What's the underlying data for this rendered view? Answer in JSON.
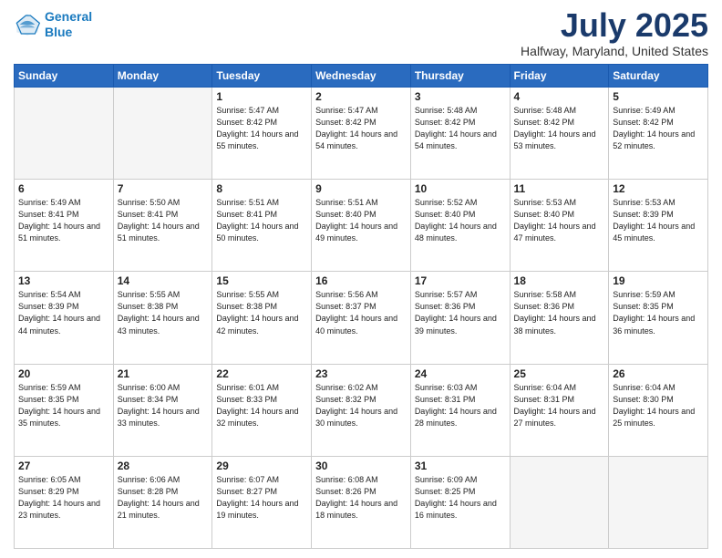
{
  "logo": {
    "line1": "General",
    "line2": "Blue"
  },
  "title": "July 2025",
  "subtitle": "Halfway, Maryland, United States",
  "days_header": [
    "Sunday",
    "Monday",
    "Tuesday",
    "Wednesday",
    "Thursday",
    "Friday",
    "Saturday"
  ],
  "weeks": [
    [
      {
        "day": "",
        "empty": true
      },
      {
        "day": "",
        "empty": true
      },
      {
        "day": "1",
        "sunrise": "5:47 AM",
        "sunset": "8:42 PM",
        "daylight": "14 hours and 55 minutes."
      },
      {
        "day": "2",
        "sunrise": "5:47 AM",
        "sunset": "8:42 PM",
        "daylight": "14 hours and 54 minutes."
      },
      {
        "day": "3",
        "sunrise": "5:48 AM",
        "sunset": "8:42 PM",
        "daylight": "14 hours and 54 minutes."
      },
      {
        "day": "4",
        "sunrise": "5:48 AM",
        "sunset": "8:42 PM",
        "daylight": "14 hours and 53 minutes."
      },
      {
        "day": "5",
        "sunrise": "5:49 AM",
        "sunset": "8:42 PM",
        "daylight": "14 hours and 52 minutes."
      }
    ],
    [
      {
        "day": "6",
        "sunrise": "5:49 AM",
        "sunset": "8:41 PM",
        "daylight": "14 hours and 51 minutes."
      },
      {
        "day": "7",
        "sunrise": "5:50 AM",
        "sunset": "8:41 PM",
        "daylight": "14 hours and 51 minutes."
      },
      {
        "day": "8",
        "sunrise": "5:51 AM",
        "sunset": "8:41 PM",
        "daylight": "14 hours and 50 minutes."
      },
      {
        "day": "9",
        "sunrise": "5:51 AM",
        "sunset": "8:40 PM",
        "daylight": "14 hours and 49 minutes."
      },
      {
        "day": "10",
        "sunrise": "5:52 AM",
        "sunset": "8:40 PM",
        "daylight": "14 hours and 48 minutes."
      },
      {
        "day": "11",
        "sunrise": "5:53 AM",
        "sunset": "8:40 PM",
        "daylight": "14 hours and 47 minutes."
      },
      {
        "day": "12",
        "sunrise": "5:53 AM",
        "sunset": "8:39 PM",
        "daylight": "14 hours and 45 minutes."
      }
    ],
    [
      {
        "day": "13",
        "sunrise": "5:54 AM",
        "sunset": "8:39 PM",
        "daylight": "14 hours and 44 minutes."
      },
      {
        "day": "14",
        "sunrise": "5:55 AM",
        "sunset": "8:38 PM",
        "daylight": "14 hours and 43 minutes."
      },
      {
        "day": "15",
        "sunrise": "5:55 AM",
        "sunset": "8:38 PM",
        "daylight": "14 hours and 42 minutes."
      },
      {
        "day": "16",
        "sunrise": "5:56 AM",
        "sunset": "8:37 PM",
        "daylight": "14 hours and 40 minutes."
      },
      {
        "day": "17",
        "sunrise": "5:57 AM",
        "sunset": "8:36 PM",
        "daylight": "14 hours and 39 minutes."
      },
      {
        "day": "18",
        "sunrise": "5:58 AM",
        "sunset": "8:36 PM",
        "daylight": "14 hours and 38 minutes."
      },
      {
        "day": "19",
        "sunrise": "5:59 AM",
        "sunset": "8:35 PM",
        "daylight": "14 hours and 36 minutes."
      }
    ],
    [
      {
        "day": "20",
        "sunrise": "5:59 AM",
        "sunset": "8:35 PM",
        "daylight": "14 hours and 35 minutes."
      },
      {
        "day": "21",
        "sunrise": "6:00 AM",
        "sunset": "8:34 PM",
        "daylight": "14 hours and 33 minutes."
      },
      {
        "day": "22",
        "sunrise": "6:01 AM",
        "sunset": "8:33 PM",
        "daylight": "14 hours and 32 minutes."
      },
      {
        "day": "23",
        "sunrise": "6:02 AM",
        "sunset": "8:32 PM",
        "daylight": "14 hours and 30 minutes."
      },
      {
        "day": "24",
        "sunrise": "6:03 AM",
        "sunset": "8:31 PM",
        "daylight": "14 hours and 28 minutes."
      },
      {
        "day": "25",
        "sunrise": "6:04 AM",
        "sunset": "8:31 PM",
        "daylight": "14 hours and 27 minutes."
      },
      {
        "day": "26",
        "sunrise": "6:04 AM",
        "sunset": "8:30 PM",
        "daylight": "14 hours and 25 minutes."
      }
    ],
    [
      {
        "day": "27",
        "sunrise": "6:05 AM",
        "sunset": "8:29 PM",
        "daylight": "14 hours and 23 minutes."
      },
      {
        "day": "28",
        "sunrise": "6:06 AM",
        "sunset": "8:28 PM",
        "daylight": "14 hours and 21 minutes."
      },
      {
        "day": "29",
        "sunrise": "6:07 AM",
        "sunset": "8:27 PM",
        "daylight": "14 hours and 19 minutes."
      },
      {
        "day": "30",
        "sunrise": "6:08 AM",
        "sunset": "8:26 PM",
        "daylight": "14 hours and 18 minutes."
      },
      {
        "day": "31",
        "sunrise": "6:09 AM",
        "sunset": "8:25 PM",
        "daylight": "14 hours and 16 minutes."
      },
      {
        "day": "",
        "empty": true
      },
      {
        "day": "",
        "empty": true
      }
    ]
  ]
}
